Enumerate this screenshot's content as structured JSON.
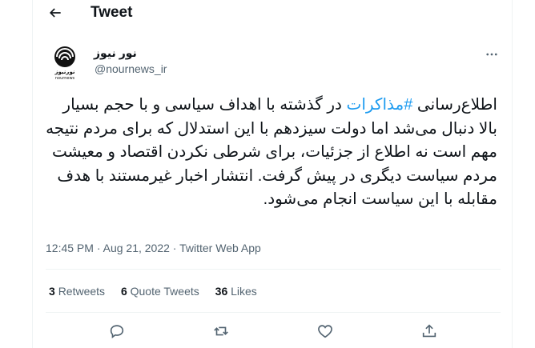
{
  "header": {
    "title": "Tweet",
    "back_icon": "arrow-left-icon"
  },
  "author": {
    "display_name": "نور نیوز",
    "handle": "@nournews_ir",
    "avatar_text": "نورنیوز",
    "avatar_subtext": "nournews",
    "avatar_icon": "nournews-logo"
  },
  "tweet": {
    "text_before": "اطلاع‌رسانی ",
    "hashtag": "#مذاکرات",
    "text_after": " در گذشته با اهداف سیاسی و با حجم بسیار بالا دنبال می‌شد اما دولت سیزدهم با این استدلال که برای مردم نتیجه مهم است نه اطلاع از جزئیات، برای شرطی نکردن اقتصاد و معیشت مردم سیاست دیگری در پیش گرفت. انتشار اخبار غیرمستند با هدف مقابله با این سیاست انجام می‌شود.",
    "hashtag_color": "#1d9bf0"
  },
  "meta": {
    "time": "12:45 PM",
    "separator": " · ",
    "date": "Aug 21, 2022",
    "source": "Twitter Web App"
  },
  "stats": [
    {
      "count": "3",
      "label": "Retweets"
    },
    {
      "count": "6",
      "label": "Quote Tweets"
    },
    {
      "count": "36",
      "label": "Likes"
    }
  ],
  "actions": [
    "reply-icon",
    "retweet-icon",
    "like-icon",
    "share-icon"
  ],
  "colors": {
    "text": "#0f1419",
    "secondary": "#536471",
    "border": "#eff3f4",
    "accent": "#1d9bf0"
  }
}
